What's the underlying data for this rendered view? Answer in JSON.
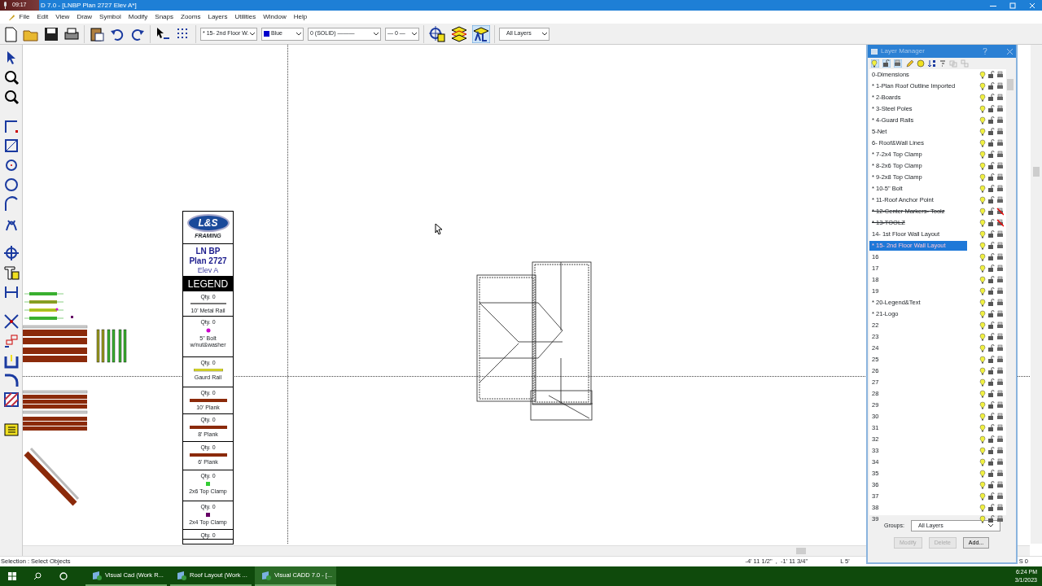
{
  "recorder_time": "09:17",
  "window": {
    "title": "D 7.0 - [LNBP Plan 2727 Elev A*]"
  },
  "menu": [
    "File",
    "Edit",
    "View",
    "Draw",
    "Symbol",
    "Modify",
    "Snaps",
    "Zooms",
    "Layers",
    "Utilities",
    "Window",
    "Help"
  ],
  "toolbar": {
    "dropdowns": [
      {
        "value": "* 15- 2nd Floor W."
      },
      {
        "value": "Blue",
        "color": "#0000cc"
      },
      {
        "value": "0 (SOLID) ———"
      },
      {
        "value": "— 0 —"
      },
      {
        "value": "All Layers"
      }
    ]
  },
  "legend": {
    "logo_text": "L&S",
    "logo_sub": "FRAMING",
    "title_lines": [
      "LN BP",
      "Plan 2727"
    ],
    "subtitle": "Elev A",
    "heading": "LEGEND",
    "items": [
      {
        "qty": "Qty. 0",
        "kind": "rail",
        "label": "10' Metal Rail"
      },
      {
        "qty": "Qty. 0",
        "kind": "dot",
        "label": "5\" Bolt w/nut&washer"
      },
      {
        "qty": "Qty. 0",
        "kind": "guard",
        "label": "Gaurd Rail"
      },
      {
        "qty": "Qty. 0",
        "kind": "plank",
        "label": "10' Plank"
      },
      {
        "qty": "Qty. 0",
        "kind": "plank",
        "label": "8' Plank"
      },
      {
        "qty": "Qty. 0",
        "kind": "plank",
        "label": "6' Plank"
      },
      {
        "qty": "Qty. 0",
        "kind": "square",
        "color": "#33cc33",
        "label": "2x6 Top Clamp"
      },
      {
        "qty": "Qty. 0",
        "kind": "square",
        "color": "#660066",
        "label": "2x4 Top Clamp"
      },
      {
        "qty": "Qty. 0",
        "kind": "none"
      }
    ]
  },
  "layer_manager": {
    "title": "Layer Manager",
    "layers": [
      {
        "name": "0-Dimensions",
        "selected": false,
        "struck": false,
        "print": true
      },
      {
        "name": "* 1-Plan Roof Outline Imported",
        "selected": false,
        "struck": false,
        "print": true
      },
      {
        "name": "* 2-Boards",
        "selected": false,
        "struck": false,
        "print": true
      },
      {
        "name": "* 3-Steel Poles",
        "selected": false,
        "struck": false,
        "print": true
      },
      {
        "name": "* 4-Guard Rails",
        "selected": false,
        "struck": false,
        "print": true
      },
      {
        "name": "5-Net",
        "selected": false,
        "struck": false,
        "print": true
      },
      {
        "name": "6- Roof&Wall Lines",
        "selected": false,
        "struck": false,
        "print": true
      },
      {
        "name": "* 7-2x4 Top Clamp",
        "selected": false,
        "struck": false,
        "print": true
      },
      {
        "name": "* 8-2x6 Top Clamp",
        "selected": false,
        "struck": false,
        "print": true
      },
      {
        "name": "* 9-2x8 Top Clamp",
        "selected": false,
        "struck": false,
        "print": true
      },
      {
        "name": "* 10-5\" Bolt",
        "selected": false,
        "struck": false,
        "print": true
      },
      {
        "name": "* 11-Roof Anchor Point",
        "selected": false,
        "struck": false,
        "print": true
      },
      {
        "name": "* 12-Center Markers- Toolz",
        "selected": false,
        "struck": true,
        "print": false
      },
      {
        "name": "* 13-TOOLZ",
        "selected": false,
        "struck": true,
        "print": false
      },
      {
        "name": "14- 1st Floor Wall Layout",
        "selected": false,
        "struck": false,
        "print": true
      },
      {
        "name": "* 15- 2nd Floor Wall Layout",
        "selected": true,
        "struck": false,
        "print": true
      },
      {
        "name": "16",
        "selected": false,
        "struck": false,
        "print": true
      },
      {
        "name": "17",
        "selected": false,
        "struck": false,
        "print": true
      },
      {
        "name": "18",
        "selected": false,
        "struck": false,
        "print": true
      },
      {
        "name": "19",
        "selected": false,
        "struck": false,
        "print": true
      },
      {
        "name": "* 20-Legend&Text",
        "selected": false,
        "struck": false,
        "print": true
      },
      {
        "name": "* 21-Logo",
        "selected": false,
        "struck": false,
        "print": true
      },
      {
        "name": "22",
        "selected": false,
        "struck": false,
        "print": true
      },
      {
        "name": "23",
        "selected": false,
        "struck": false,
        "print": true
      },
      {
        "name": "24",
        "selected": false,
        "struck": false,
        "print": true
      },
      {
        "name": "25",
        "selected": false,
        "struck": false,
        "print": true
      },
      {
        "name": "26",
        "selected": false,
        "struck": false,
        "print": true
      },
      {
        "name": "27",
        "selected": false,
        "struck": false,
        "print": true
      },
      {
        "name": "28",
        "selected": false,
        "struck": false,
        "print": true
      },
      {
        "name": "29",
        "selected": false,
        "struck": false,
        "print": true
      },
      {
        "name": "30",
        "selected": false,
        "struck": false,
        "print": true
      },
      {
        "name": "31",
        "selected": false,
        "struck": false,
        "print": true
      },
      {
        "name": "32",
        "selected": false,
        "struck": false,
        "print": true
      },
      {
        "name": "33",
        "selected": false,
        "struck": false,
        "print": true
      },
      {
        "name": "34",
        "selected": false,
        "struck": false,
        "print": true
      },
      {
        "name": "35",
        "selected": false,
        "struck": false,
        "print": true
      },
      {
        "name": "36",
        "selected": false,
        "struck": false,
        "print": true
      },
      {
        "name": "37",
        "selected": false,
        "struck": false,
        "print": true
      },
      {
        "name": "38",
        "selected": false,
        "struck": false,
        "print": true
      },
      {
        "name": "39",
        "selected": false,
        "struck": false,
        "print": true
      }
    ],
    "groups_label": "Groups:",
    "groups_value": "All Layers",
    "buttons": [
      {
        "label": "Modify",
        "disabled": true
      },
      {
        "label": "Delete",
        "disabled": true
      },
      {
        "label": "Add...",
        "disabled": false
      }
    ]
  },
  "status_bar": {
    "message": "Selection : Select Objects",
    "coordinates": "-4' 11 1/2\"  ,  -1' 11 3/4\"",
    "length": "L 5'",
    "snap": "S 0"
  },
  "taskbar": {
    "apps": [
      {
        "label": "Visual Cad (Work R...",
        "selected": false
      },
      {
        "label": "Roof Layout (Work ...",
        "selected": false
      },
      {
        "label": "Visual CADD 7.0 - [...",
        "selected": true
      }
    ],
    "time": "6:24 PM",
    "date": "3/1/2023"
  }
}
